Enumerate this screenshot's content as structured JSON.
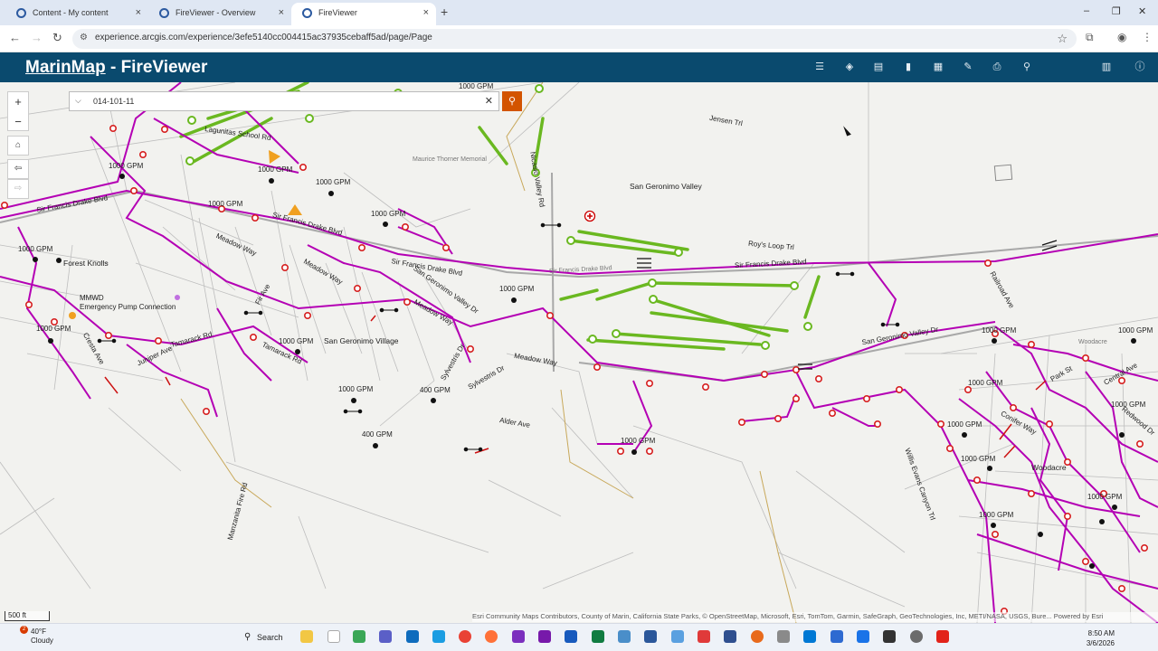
{
  "browser": {
    "tabs": [
      {
        "title": "Content - My content"
      },
      {
        "title": "FireViewer - Overview"
      },
      {
        "title": "FireViewer"
      }
    ],
    "new_tab": "+",
    "close_glyph": "×",
    "url": "experience.arcgis.com/experience/3efe5140cc004415ac37935cebaff5ad/page/Page",
    "window_controls": [
      "–",
      "❐",
      "✕"
    ]
  },
  "app": {
    "title_brand": "MarinMap",
    "title_rest": " - FireViewer"
  },
  "search": {
    "value": "014-101-11"
  },
  "map": {
    "scale_label": "500 ft",
    "attribution": "Esri Community Maps Contributors, County of Marin, California State Parks, © OpenStreetMap, Microsoft, Esri, TomTom, Garmin, SafeGraph, GeoTechnologies, Inc, METI/NASA, USGS, Bure...     Powered by Esri",
    "labels": {
      "sir_francis_drake_1": "Sir Francis Drake Blvd",
      "sir_francis_drake_2": "Sir Francis Drake Blvd",
      "sir_francis_drake_3": "Sir Francis Drake Blvd",
      "sir_francis_drake_4": "Sir Francis Drake Blvd",
      "sir_francis_drake_5": "Sir Francis Drake Blvd",
      "san_geronimo_valley": "San Geronimo Valley",
      "san_geronimo_village": "San Geronimo Village",
      "san_geronimo_valley_dr_1": "San Geronimo Valley Dr",
      "san_geronimo_valley_dr_2": "San Geronimo Valley Dr",
      "forest_knolls": "Forest Knolls",
      "mmwd": "MMWD",
      "emergency_pump": "Emergency Pump Connection",
      "lagunitas_school": "Lagunitas School Rd",
      "meadow_way_1": "Meadow Way",
      "meadow_way_2": "Meadow Way",
      "meadow_way_3": "Meadow Way",
      "meadow_way_4": "Meadow Way",
      "tamarack_1": "Tamarack Rd",
      "tamarack_2": "Tamarack Rd",
      "roys_loop": "Roy's Loop Trl",
      "jensen": "Jensen Trl",
      "nicasio": "Nicasio Valley Rd",
      "alder": "Alder Ave",
      "sylvestris": "Sylvestris Dr",
      "sylvestris_2": "Sylvestris Dr",
      "manzanita": "Manzanita Fire Rd",
      "willis_evans": "Willis Evans Canyon Trl",
      "railroad": "Railroad Ave",
      "woodacre": "Woodacre",
      "woodacre_2": "Woodacre",
      "maurice_thorner": "Maurice Thorner Memorial",
      "fir_ave": "Fir Ave",
      "juniper": "Juniper Ave",
      "cresta": "Cresta Ave",
      "conifer": "Conifer Way",
      "park_st": "Park St",
      "central_ave": "Central Ave",
      "redwood": "Redwood Dr",
      "gpm_a": "1000 GPM",
      "gpm_b": "1000 GPM",
      "gpm_c": "1000 GPM",
      "gpm_d": "1000 GPM",
      "gpm_e": "1000 GPM",
      "gpm_f": "1000 GPM",
      "gpm_g": "1000 GPM",
      "gpm_h": "1000 GPM",
      "gpm_i": "1000 GPM",
      "gpm_j": "1000 GPM",
      "gpm_k": "1000 GPM",
      "gpm_l": "1000 GPM",
      "gpm_m": "1000 GPM",
      "gpm_n": "1000 GPM",
      "gpm_o": "1000 GPM",
      "gpm_p": "1000 GPM",
      "gpm_q": "1000 GPM",
      "gpm_r": "1000 GPM",
      "gpm_s": "1000 GPM",
      "gpm_t": "1000 GPM",
      "gpm_400a": "400 GPM",
      "gpm_400b": "400 GPM"
    }
  },
  "taskbar": {
    "notifications": "2",
    "temperature": "40°F",
    "condition": "Cloudy",
    "search_label": "Search",
    "time": "8:50 AM",
    "date": "3/6/2026"
  },
  "colors": {
    "header": "#0a4a6e",
    "water_main": "#b400b4",
    "hydrant": "#d62020",
    "trail_green": "#6ab820",
    "search_button": "#d35400"
  }
}
